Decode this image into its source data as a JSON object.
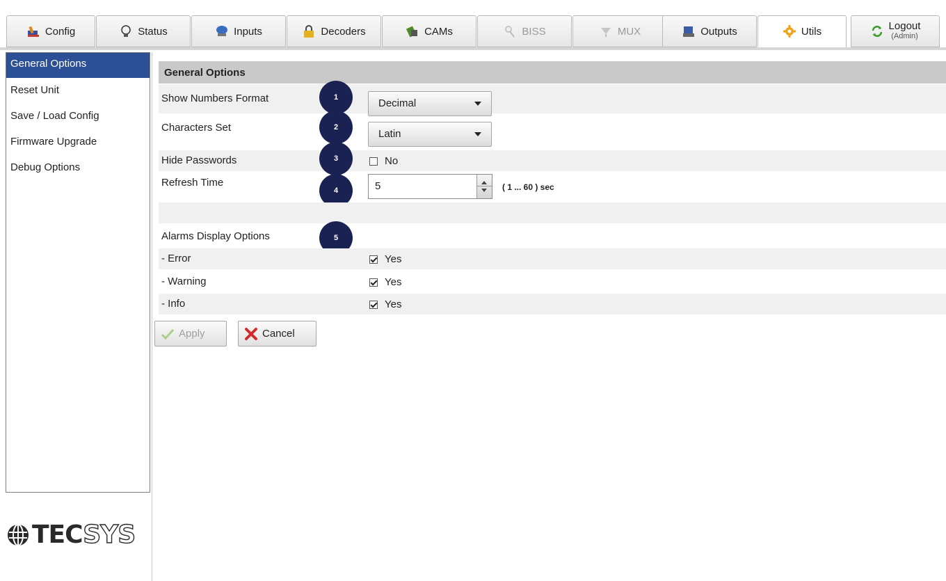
{
  "tabs": [
    {
      "label": "Config",
      "icon": "config-icon"
    },
    {
      "label": "Status",
      "icon": "status-icon"
    },
    {
      "label": "Inputs",
      "icon": "inputs-icon"
    },
    {
      "label": "Decoders",
      "icon": "decoders-icon"
    },
    {
      "label": "CAMs",
      "icon": "cams-icon"
    },
    {
      "label": "BISS",
      "icon": "biss-icon",
      "disabled": true
    },
    {
      "label": "MUX",
      "icon": "mux-icon",
      "disabled": true
    },
    {
      "label": "Outputs",
      "icon": "outputs-icon"
    },
    {
      "label": "Utils",
      "icon": "utils-icon",
      "active": true
    },
    {
      "label": "Logout",
      "sub": "(Admin)",
      "icon": "logout-icon"
    }
  ],
  "sidebar": {
    "items": [
      {
        "label": "General Options",
        "active": true
      },
      {
        "label": "Reset Unit"
      },
      {
        "label": "Save / Load Config"
      },
      {
        "label": "Firmware Upgrade"
      },
      {
        "label": "Debug Options"
      }
    ]
  },
  "panel": {
    "title": "General Options",
    "show_numbers_format": {
      "label": "Show Numbers Format",
      "value": "Decimal",
      "badge": "1"
    },
    "characters_set": {
      "label": "Characters Set",
      "value": "Latin",
      "badge": "2"
    },
    "hide_passwords": {
      "label": "Hide Passwords",
      "checked": false,
      "text": "No",
      "badge": "3"
    },
    "refresh_time": {
      "label": "Refresh Time",
      "value": "5",
      "range": "( 1 ... 60 ) sec",
      "badge": "4"
    },
    "alarms": {
      "label": "Alarms Display Options",
      "badge": "5"
    },
    "error": {
      "label": "- Error",
      "checked": true,
      "text": "Yes"
    },
    "warning": {
      "label": "- Warning",
      "checked": true,
      "text": "Yes"
    },
    "info": {
      "label": "- Info",
      "checked": true,
      "text": "Yes"
    }
  },
  "buttons": {
    "apply": "Apply",
    "cancel": "Cancel"
  },
  "logo": {
    "prefix": "TEC",
    "suffix": "SYS"
  },
  "colors": {
    "sidebar_active": "#2c4f96",
    "badge": "#1a2253",
    "header": "#c9c9c9"
  }
}
